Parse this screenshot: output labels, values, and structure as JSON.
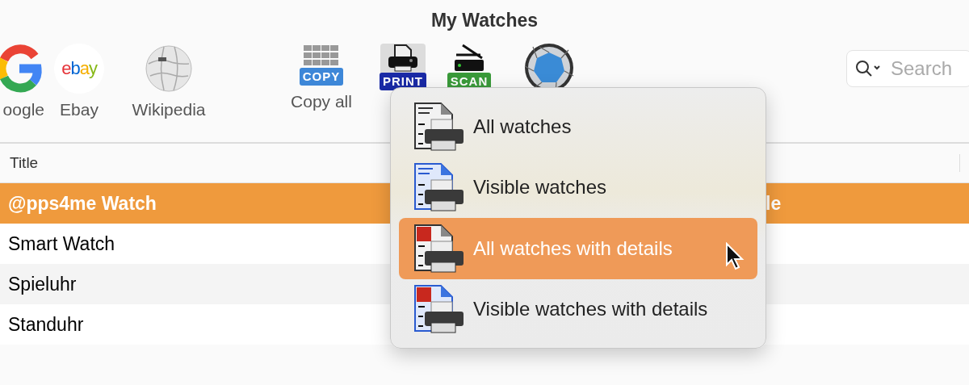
{
  "window": {
    "title": "My Watches"
  },
  "toolbar": [
    {
      "kind": "google",
      "label": "oogle",
      "pressed": false
    },
    {
      "kind": "ebay",
      "label": "Ebay",
      "logo_text": "ebay",
      "pressed": false
    },
    {
      "kind": "wikipedia",
      "label": "Wikipedia",
      "pressed": false
    },
    {
      "kind": "copy",
      "label": "Copy all",
      "badge": "COPY",
      "pressed": false
    },
    {
      "kind": "print",
      "badge": "PRINT",
      "pressed": true
    },
    {
      "kind": "scan",
      "badge": "SCAN",
      "pressed": false
    },
    {
      "kind": "aperture",
      "pressed": false
    }
  ],
  "search": {
    "placeholder": "Search"
  },
  "table": {
    "columns": [
      "Title"
    ],
    "rows": [
      {
        "cells": [
          "@pps4me Watch",
          "le"
        ],
        "selected": true
      },
      {
        "cells": [
          "Smart Watch"
        ],
        "selected": false
      },
      {
        "cells": [
          "Spieluhr"
        ],
        "selected": false
      },
      {
        "cells": [
          "Standuhr"
        ],
        "selected": false
      }
    ]
  },
  "print_menu": {
    "items": [
      {
        "kind": "all",
        "label": "All watches",
        "selected": false
      },
      {
        "kind": "visible",
        "label": "Visible watches",
        "selected": false
      },
      {
        "kind": "all-details",
        "label": "All watches with details",
        "selected": true
      },
      {
        "kind": "visible-details",
        "label": "Visible watches with details",
        "selected": false
      }
    ]
  }
}
